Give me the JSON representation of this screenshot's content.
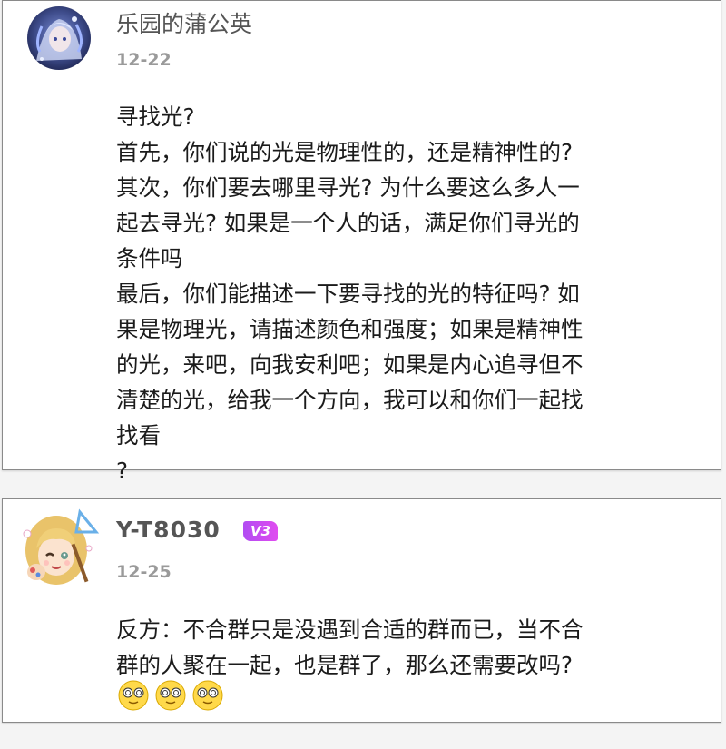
{
  "comments": [
    {
      "username": "乐园的蒲公英",
      "date": "12-22",
      "lines": [
        "寻找光?",
        "首先，你们说的光是物理性的，还是精神性的?",
        "其次，你们要去哪里寻光? 为什么要这么多人一",
        "起去寻光? 如果是一个人的话，满足你们寻光的",
        "条件吗",
        "最后，你们能描述一下要寻找的光的特征吗? 如",
        "果是物理光，请描述颜色和强度；如果是精神性",
        "的光，来吧，向我安利吧；如果是内心追寻但不",
        "清楚的光，给我一个方向，我可以和你们一起找",
        "找看",
        "?"
      ],
      "avatar_icon": "anime-girl-avatar-blue"
    },
    {
      "username": "Y-T8030",
      "level_badge": "V3",
      "date": "12-25",
      "lines": [
        "反方：不合群只是没遇到合适的群而已，当不合",
        "群的人聚在一起，也是群了，那么还需要改吗?"
      ],
      "emojis": [
        "dizzy-face-emoji",
        "dizzy-face-emoji",
        "dizzy-face-emoji"
      ],
      "avatar_icon": "cartoon-girl-avatar-yellow"
    }
  ],
  "colors": {
    "username": "#555555",
    "date": "#9a9a9a",
    "text": "#1b1b1b",
    "badge": "#c94cf0",
    "card_border": "#8a8a8a"
  }
}
